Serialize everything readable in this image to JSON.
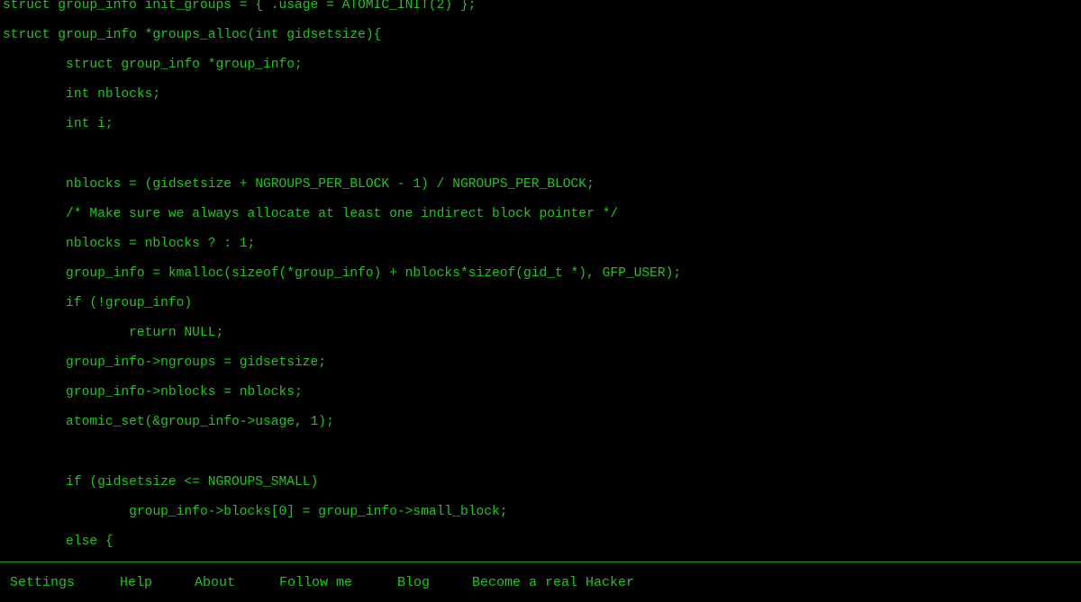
{
  "code_lines": [
    "struct group_info init_groups = { .usage = ATOMIC_INIT(2) };",
    "struct group_info *groups_alloc(int gidsetsize){",
    "        struct group_info *group_info;",
    "        int nblocks;",
    "        int i;",
    "",
    "        nblocks = (gidsetsize + NGROUPS_PER_BLOCK - 1) / NGROUPS_PER_BLOCK;",
    "        /* Make sure we always allocate at least one indirect block pointer */",
    "        nblocks = nblocks ? : 1;",
    "        group_info = kmalloc(sizeof(*group_info) + nblocks*sizeof(gid_t *), GFP_USER);",
    "        if (!group_info)",
    "                return NULL;",
    "        group_info->ngroups = gidsetsize;",
    "        group_info->nblocks = nblocks;",
    "        atomic_set(&group_info->usage, 1);",
    "",
    "        if (gidsetsize <= NGROUPS_SMALL)",
    "                group_info->blocks[0] = group_info->small_block;",
    "        else {"
  ],
  "footer": {
    "items": [
      "Settings",
      "Help",
      "About",
      "Follow me",
      "Blog",
      "Become a real Hacker"
    ]
  },
  "colors": {
    "text": "#22c422",
    "background": "#000000"
  }
}
